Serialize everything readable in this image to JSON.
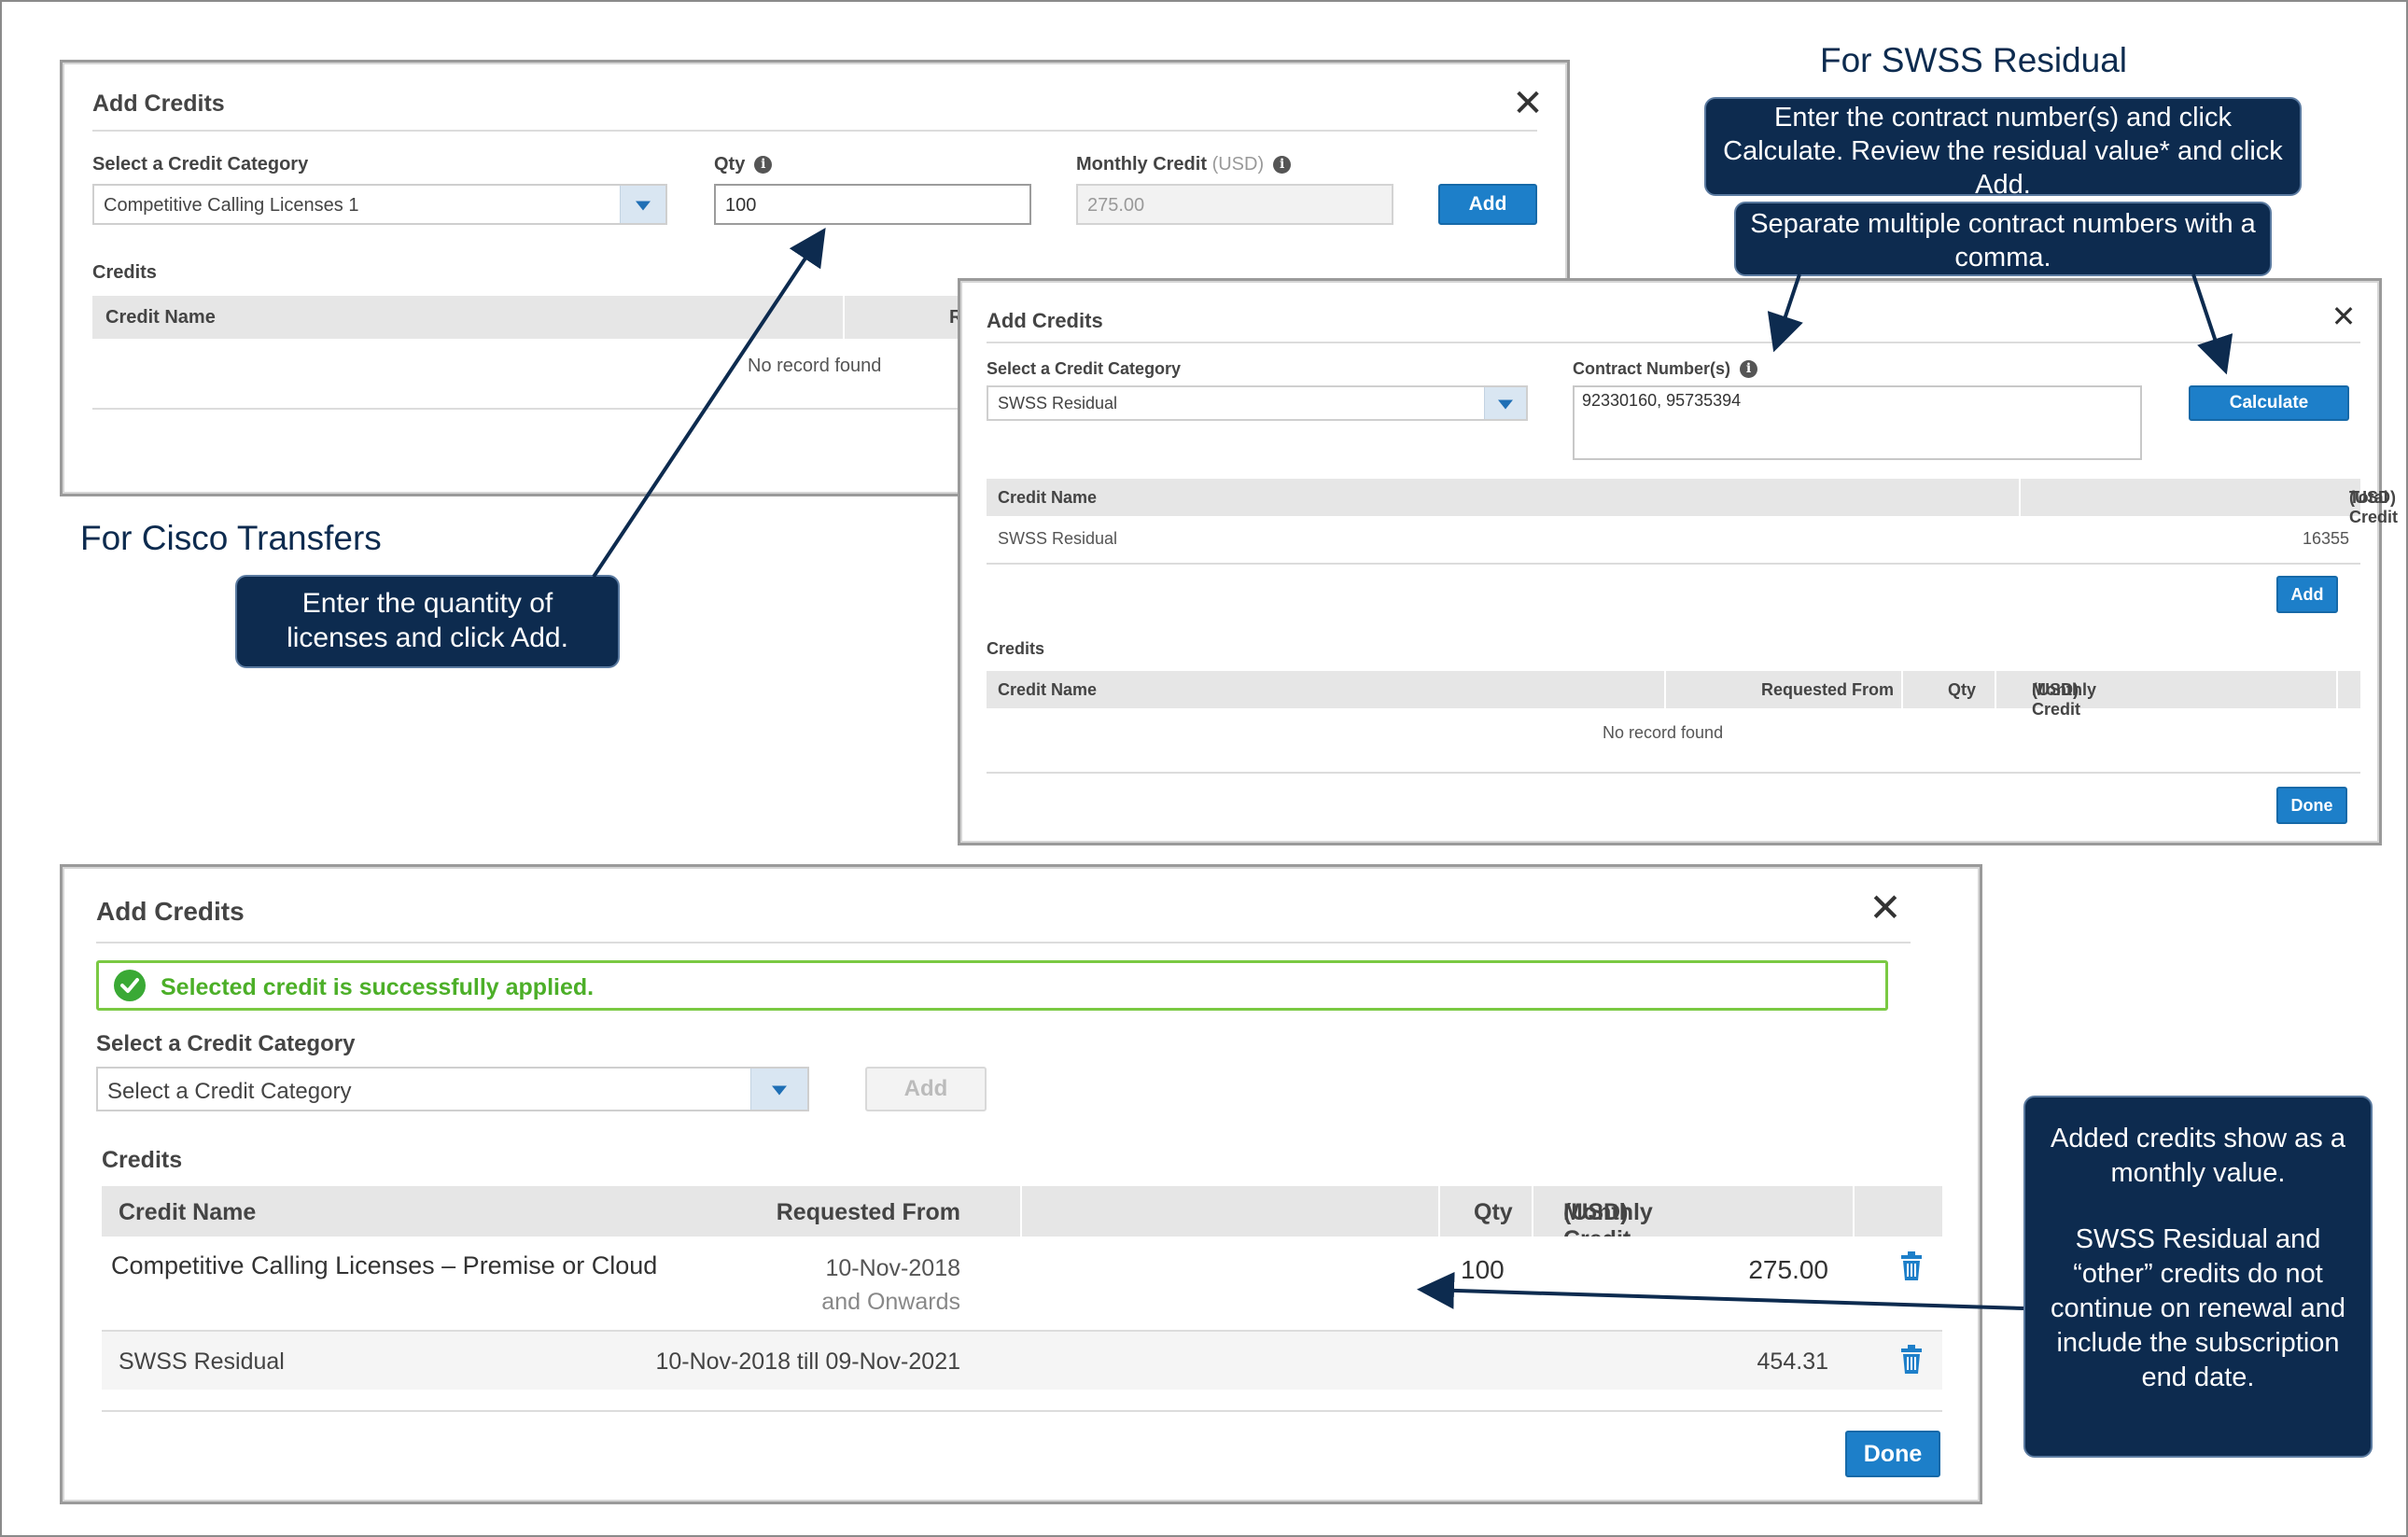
{
  "headings": {
    "swss": "For SWSS Residual",
    "cisco": "For Cisco Transfers"
  },
  "callouts": {
    "swss_instructions": "Enter the contract number(s) and click Calculate. Review the residual value* and click Add.",
    "separate": "Separate multiple contract numbers with a comma.",
    "qty": "Enter the quantity of licenses and click Add.",
    "added": "Added credits show as a monthly value.",
    "added_2": "SWSS Residual and “other” credits do not continue on renewal and include the subscription end date."
  },
  "dialog1": {
    "title": "Add Credits",
    "category_label": "Select a Credit Category",
    "category_value": "Competitive Calling Licenses 1",
    "qty_label": "Qty",
    "qty_value": "100",
    "monthly_label": "Monthly Credit",
    "monthly_unit": "(USD)",
    "monthly_value": "275.00",
    "add_button": "Add",
    "credits_label": "Credits",
    "col_credit_name": "Credit Name",
    "col_requested": "Requ",
    "empty": "No record found"
  },
  "dialog2": {
    "title": "Add Credits",
    "category_label": "Select a Credit Category",
    "category_value": "SWSS Residual",
    "contract_label": "Contract Number(s)",
    "contract_value": "92330160, 95735394",
    "calculate_button": "Calculate",
    "top_table": {
      "col_credit_name": "Credit Name",
      "col_total_credit": "Total Credit",
      "col_total_unit": "(USD)",
      "row_name": "SWSS Residual",
      "row_total": "16355"
    },
    "add_button": "Add",
    "credits_label": "Credits",
    "credits_table": {
      "col_credit_name": "Credit Name",
      "col_requested": "Requested From",
      "col_qty": "Qty",
      "col_monthly": "Monthly Credit",
      "col_monthly_unit": "(USD)",
      "empty": "No record found"
    },
    "done_button": "Done"
  },
  "dialog3": {
    "title": "Add Credits",
    "success_message": "Selected credit is successfully applied.",
    "category_label": "Select a Credit Category",
    "category_placeholder": "Select a Credit Category",
    "add_button": "Add",
    "credits_label": "Credits",
    "columns": {
      "credit_name": "Credit Name",
      "requested": "Requested From",
      "qty": "Qty",
      "monthly": "Monthly Credit",
      "monthly_unit": "(USD)"
    },
    "rows": [
      {
        "name": "Competitive Calling Licenses – Premise or Cloud",
        "requested_line1": "10-Nov-2018",
        "requested_line2": "and Onwards",
        "qty": "100",
        "monthly": "275.00"
      },
      {
        "name": "SWSS Residual",
        "requested_line1": "10-Nov-2018 till 09-Nov-2021",
        "requested_line2": "",
        "qty": "",
        "monthly": "454.31"
      }
    ],
    "done_button": "Done"
  },
  "colors": {
    "callout_bg": "#0d2b4f",
    "button_blue": "#1d7fc9",
    "success_green": "#3aa935"
  }
}
